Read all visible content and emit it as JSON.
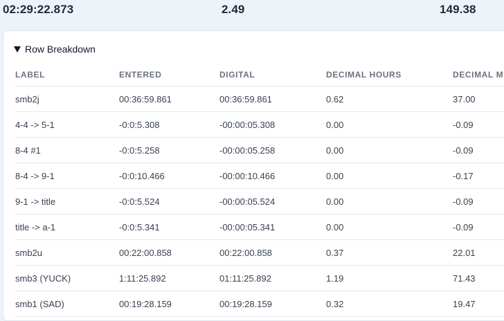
{
  "totals": {
    "time": "02:29:22.873",
    "hours": "2.49",
    "minutes": "149.38"
  },
  "breakdown": {
    "title": "Row Breakdown",
    "columns": [
      "LABEL",
      "ENTERED",
      "DIGITAL",
      "DECIMAL HOURS",
      "DECIMAL MI"
    ],
    "rows": [
      {
        "label": "smb2j",
        "entered": "00:36:59.861",
        "digital": "00:36:59.861",
        "hours": "0.62",
        "minutes": "37.00"
      },
      {
        "label": "4-4 -> 5-1",
        "entered": "-0:0:5.308",
        "digital": "-00:00:05.308",
        "hours": "0.00",
        "minutes": "-0.09"
      },
      {
        "label": "8-4 #1",
        "entered": "-0:0:5.258",
        "digital": "-00:00:05.258",
        "hours": "0.00",
        "minutes": "-0.09"
      },
      {
        "label": "8-4 -> 9-1",
        "entered": "-0:0:10.466",
        "digital": "-00:00:10.466",
        "hours": "0.00",
        "minutes": "-0.17"
      },
      {
        "label": "9-1 -> title",
        "entered": "-0:0:5.524",
        "digital": "-00:00:05.524",
        "hours": "0.00",
        "minutes": "-0.09"
      },
      {
        "label": "title -> a-1",
        "entered": "-0:0:5.341",
        "digital": "-00:00:05.341",
        "hours": "0.00",
        "minutes": "-0.09"
      },
      {
        "label": "smb2u",
        "entered": "00:22:00.858",
        "digital": "00:22:00.858",
        "hours": "0.37",
        "minutes": "22.01"
      },
      {
        "label": "smb3 (YUCK)",
        "entered": "1:11:25.892",
        "digital": "01:11:25.892",
        "hours": "1.19",
        "minutes": "71.43"
      },
      {
        "label": "smb1 (SAD)",
        "entered": "00:19:28.159",
        "digital": "00:19:28.159",
        "hours": "0.32",
        "minutes": "19.47"
      }
    ]
  }
}
